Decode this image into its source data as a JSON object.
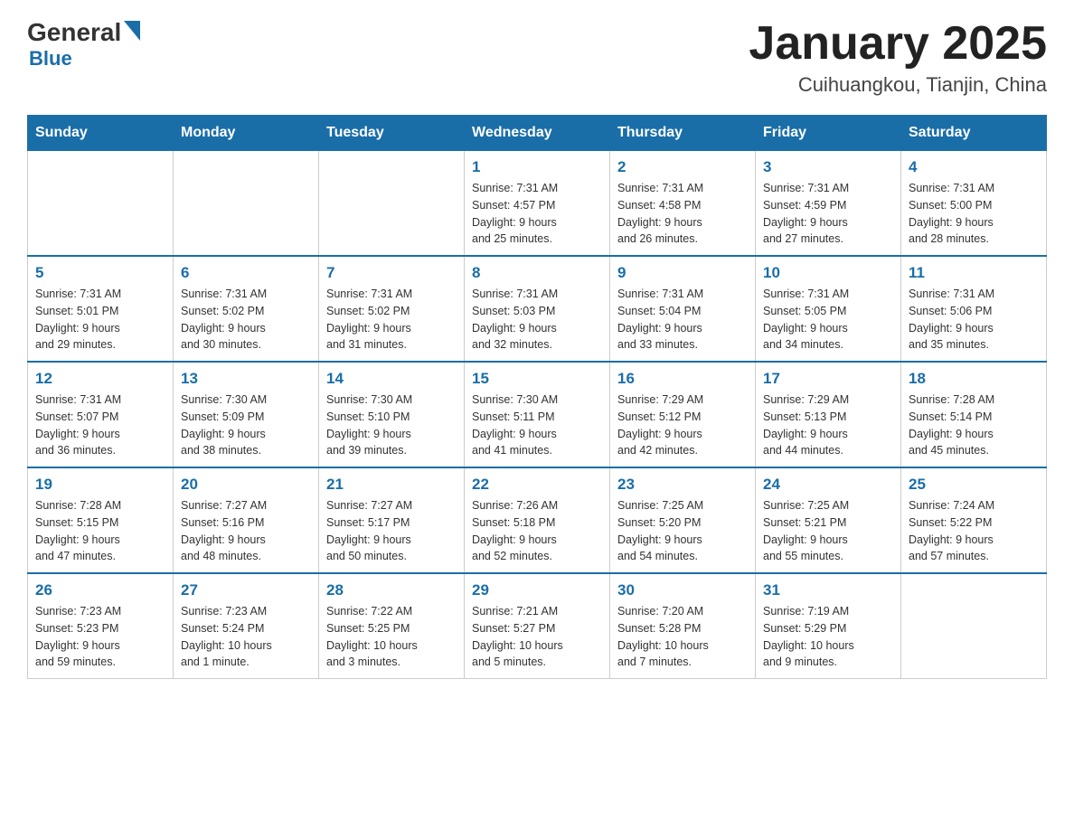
{
  "header": {
    "logo_general": "General",
    "logo_blue": "Blue",
    "month_title": "January 2025",
    "location": "Cuihuangkou, Tianjin, China"
  },
  "days_of_week": [
    "Sunday",
    "Monday",
    "Tuesday",
    "Wednesday",
    "Thursday",
    "Friday",
    "Saturday"
  ],
  "weeks": [
    [
      {
        "day": "",
        "info": ""
      },
      {
        "day": "",
        "info": ""
      },
      {
        "day": "",
        "info": ""
      },
      {
        "day": "1",
        "info": "Sunrise: 7:31 AM\nSunset: 4:57 PM\nDaylight: 9 hours\nand 25 minutes."
      },
      {
        "day": "2",
        "info": "Sunrise: 7:31 AM\nSunset: 4:58 PM\nDaylight: 9 hours\nand 26 minutes."
      },
      {
        "day": "3",
        "info": "Sunrise: 7:31 AM\nSunset: 4:59 PM\nDaylight: 9 hours\nand 27 minutes."
      },
      {
        "day": "4",
        "info": "Sunrise: 7:31 AM\nSunset: 5:00 PM\nDaylight: 9 hours\nand 28 minutes."
      }
    ],
    [
      {
        "day": "5",
        "info": "Sunrise: 7:31 AM\nSunset: 5:01 PM\nDaylight: 9 hours\nand 29 minutes."
      },
      {
        "day": "6",
        "info": "Sunrise: 7:31 AM\nSunset: 5:02 PM\nDaylight: 9 hours\nand 30 minutes."
      },
      {
        "day": "7",
        "info": "Sunrise: 7:31 AM\nSunset: 5:02 PM\nDaylight: 9 hours\nand 31 minutes."
      },
      {
        "day": "8",
        "info": "Sunrise: 7:31 AM\nSunset: 5:03 PM\nDaylight: 9 hours\nand 32 minutes."
      },
      {
        "day": "9",
        "info": "Sunrise: 7:31 AM\nSunset: 5:04 PM\nDaylight: 9 hours\nand 33 minutes."
      },
      {
        "day": "10",
        "info": "Sunrise: 7:31 AM\nSunset: 5:05 PM\nDaylight: 9 hours\nand 34 minutes."
      },
      {
        "day": "11",
        "info": "Sunrise: 7:31 AM\nSunset: 5:06 PM\nDaylight: 9 hours\nand 35 minutes."
      }
    ],
    [
      {
        "day": "12",
        "info": "Sunrise: 7:31 AM\nSunset: 5:07 PM\nDaylight: 9 hours\nand 36 minutes."
      },
      {
        "day": "13",
        "info": "Sunrise: 7:30 AM\nSunset: 5:09 PM\nDaylight: 9 hours\nand 38 minutes."
      },
      {
        "day": "14",
        "info": "Sunrise: 7:30 AM\nSunset: 5:10 PM\nDaylight: 9 hours\nand 39 minutes."
      },
      {
        "day": "15",
        "info": "Sunrise: 7:30 AM\nSunset: 5:11 PM\nDaylight: 9 hours\nand 41 minutes."
      },
      {
        "day": "16",
        "info": "Sunrise: 7:29 AM\nSunset: 5:12 PM\nDaylight: 9 hours\nand 42 minutes."
      },
      {
        "day": "17",
        "info": "Sunrise: 7:29 AM\nSunset: 5:13 PM\nDaylight: 9 hours\nand 44 minutes."
      },
      {
        "day": "18",
        "info": "Sunrise: 7:28 AM\nSunset: 5:14 PM\nDaylight: 9 hours\nand 45 minutes."
      }
    ],
    [
      {
        "day": "19",
        "info": "Sunrise: 7:28 AM\nSunset: 5:15 PM\nDaylight: 9 hours\nand 47 minutes."
      },
      {
        "day": "20",
        "info": "Sunrise: 7:27 AM\nSunset: 5:16 PM\nDaylight: 9 hours\nand 48 minutes."
      },
      {
        "day": "21",
        "info": "Sunrise: 7:27 AM\nSunset: 5:17 PM\nDaylight: 9 hours\nand 50 minutes."
      },
      {
        "day": "22",
        "info": "Sunrise: 7:26 AM\nSunset: 5:18 PM\nDaylight: 9 hours\nand 52 minutes."
      },
      {
        "day": "23",
        "info": "Sunrise: 7:25 AM\nSunset: 5:20 PM\nDaylight: 9 hours\nand 54 minutes."
      },
      {
        "day": "24",
        "info": "Sunrise: 7:25 AM\nSunset: 5:21 PM\nDaylight: 9 hours\nand 55 minutes."
      },
      {
        "day": "25",
        "info": "Sunrise: 7:24 AM\nSunset: 5:22 PM\nDaylight: 9 hours\nand 57 minutes."
      }
    ],
    [
      {
        "day": "26",
        "info": "Sunrise: 7:23 AM\nSunset: 5:23 PM\nDaylight: 9 hours\nand 59 minutes."
      },
      {
        "day": "27",
        "info": "Sunrise: 7:23 AM\nSunset: 5:24 PM\nDaylight: 10 hours\nand 1 minute."
      },
      {
        "day": "28",
        "info": "Sunrise: 7:22 AM\nSunset: 5:25 PM\nDaylight: 10 hours\nand 3 minutes."
      },
      {
        "day": "29",
        "info": "Sunrise: 7:21 AM\nSunset: 5:27 PM\nDaylight: 10 hours\nand 5 minutes."
      },
      {
        "day": "30",
        "info": "Sunrise: 7:20 AM\nSunset: 5:28 PM\nDaylight: 10 hours\nand 7 minutes."
      },
      {
        "day": "31",
        "info": "Sunrise: 7:19 AM\nSunset: 5:29 PM\nDaylight: 10 hours\nand 9 minutes."
      },
      {
        "day": "",
        "info": ""
      }
    ]
  ]
}
